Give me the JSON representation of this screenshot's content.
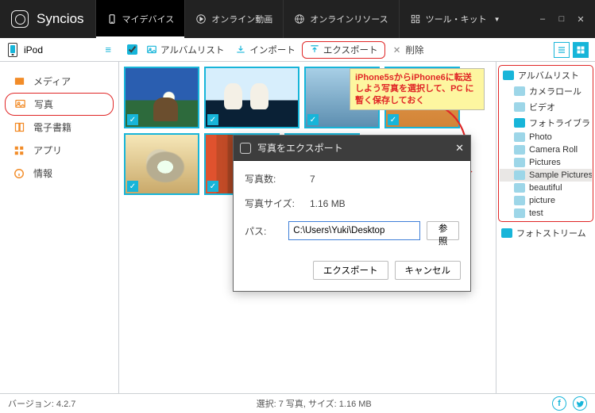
{
  "brand": "Syncios",
  "tabs": {
    "device": "マイデバイス",
    "video": "オンライン動画",
    "resource": "オンラインリソース",
    "tools": "ツール・キット"
  },
  "device_label": "iPod",
  "toolbar": {
    "album": "アルバムリスト",
    "import": "インポート",
    "export": "エクスポート",
    "delete": "削除"
  },
  "sidebar": {
    "media": "メディア",
    "photo": "写真",
    "ebook": "電子書籍",
    "apps": "アプリ",
    "info": "情報"
  },
  "callout_text": "iPhone5sからiPhone6に転送しよう写真を選択して、PC に暫く保存しておく",
  "dialog": {
    "title": "写真をエクスポート",
    "count_label": "写真数:",
    "count_value": "7",
    "size_label": "写真サイズ:",
    "size_value": "1.16 MB",
    "path_label": "パス:",
    "path_value": "C:\\Users\\Yuki\\Desktop",
    "browse": "参照",
    "export": "エクスポート",
    "cancel": "キャンセル"
  },
  "tree": {
    "albumlist": "アルバムリスト",
    "camera_roll_jp": "カメラロール",
    "video": "ビデオ",
    "photo_library": "フォトライブラリー",
    "photo": "Photo",
    "camera_roll": "Camera Roll",
    "pictures": "Pictures",
    "sample": "Sample Pictures",
    "beautiful": "beautiful",
    "picture": "picture",
    "test": "test",
    "photostream": "フォトストリーム"
  },
  "status": {
    "version_label": "バージョン: ",
    "version": "4.2.7",
    "selection": "選択: 7 写真, サイズ: 1.16 MB"
  }
}
